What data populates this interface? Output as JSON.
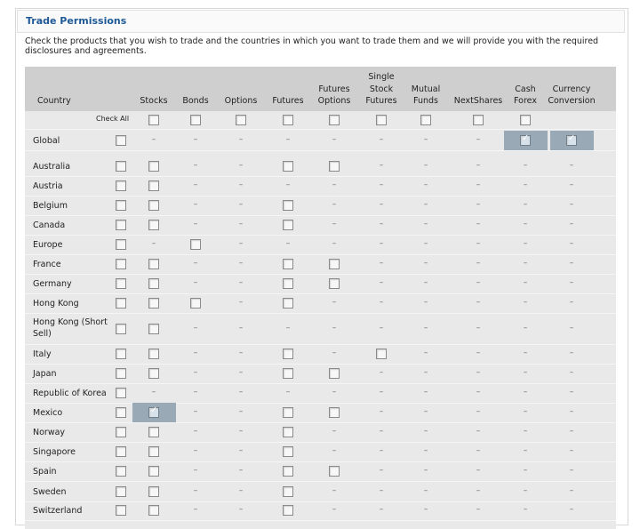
{
  "title": "Trade Permissions",
  "intro": "Check the products that you wish to trade and the countries in which you want to trade them and we will provide you with the required disclosures and agreements.",
  "header": {
    "country": "Country",
    "columns": [
      {
        "key": "stocks",
        "lines": [
          "Stocks"
        ]
      },
      {
        "key": "bonds",
        "lines": [
          "Bonds"
        ]
      },
      {
        "key": "options",
        "lines": [
          "Options"
        ]
      },
      {
        "key": "futures",
        "lines": [
          "Futures"
        ]
      },
      {
        "key": "futures_options",
        "lines": [
          "Futures",
          "Options"
        ]
      },
      {
        "key": "single_stock_futures",
        "lines": [
          "Single",
          "Stock",
          "Futures"
        ]
      },
      {
        "key": "mutual_funds",
        "lines": [
          "Mutual",
          "Funds"
        ]
      },
      {
        "key": "nextshares",
        "lines": [
          "NextShares"
        ]
      },
      {
        "key": "cash_forex",
        "lines": [
          "Cash",
          "Forex"
        ]
      },
      {
        "key": "currency_conversion",
        "lines": [
          "Currency",
          "Conversion"
        ]
      }
    ]
  },
  "check_all_label": "Check All",
  "check_all": [
    "box",
    "box",
    "box",
    "box",
    "box",
    "box",
    "box",
    "box",
    "box",
    "none"
  ],
  "rows": [
    {
      "country": "Global",
      "cells": [
        "dash",
        "dash",
        "dash",
        "dash",
        "dash",
        "dash",
        "dash",
        "dash",
        "checked",
        "checked"
      ]
    },
    {
      "country": "Australia",
      "cells": [
        "box",
        "dash",
        "dash",
        "box",
        "box",
        "dash",
        "dash",
        "dash",
        "dash",
        "dash"
      ]
    },
    {
      "country": "Austria",
      "cells": [
        "box",
        "dash",
        "dash",
        "dash",
        "dash",
        "dash",
        "dash",
        "dash",
        "dash",
        "dash"
      ]
    },
    {
      "country": "Belgium",
      "cells": [
        "box",
        "dash",
        "dash",
        "box",
        "dash",
        "dash",
        "dash",
        "dash",
        "dash",
        "dash"
      ]
    },
    {
      "country": "Canada",
      "cells": [
        "box",
        "dash",
        "dash",
        "box",
        "dash",
        "dash",
        "dash",
        "dash",
        "dash",
        "dash"
      ]
    },
    {
      "country": "Europe",
      "cells": [
        "dash",
        "box",
        "dash",
        "dash",
        "dash",
        "dash",
        "dash",
        "dash",
        "dash",
        "dash"
      ]
    },
    {
      "country": "France",
      "cells": [
        "box",
        "dash",
        "dash",
        "box",
        "box",
        "dash",
        "dash",
        "dash",
        "dash",
        "dash"
      ]
    },
    {
      "country": "Germany",
      "cells": [
        "box",
        "dash",
        "dash",
        "box",
        "box",
        "dash",
        "dash",
        "dash",
        "dash",
        "dash"
      ]
    },
    {
      "country": "Hong Kong",
      "cells": [
        "box",
        "box",
        "dash",
        "box",
        "dash",
        "dash",
        "dash",
        "dash",
        "dash",
        "dash"
      ]
    },
    {
      "country": "Hong Kong (Short Sell)",
      "cells": [
        "box",
        "dash",
        "dash",
        "dash",
        "dash",
        "dash",
        "dash",
        "dash",
        "dash",
        "dash"
      ]
    },
    {
      "country": "Italy",
      "cells": [
        "box",
        "dash",
        "dash",
        "box",
        "dash",
        "box",
        "dash",
        "dash",
        "dash",
        "dash"
      ]
    },
    {
      "country": "Japan",
      "cells": [
        "box",
        "dash",
        "dash",
        "box",
        "box",
        "dash",
        "dash",
        "dash",
        "dash",
        "dash"
      ]
    },
    {
      "country": "Republic of Korea",
      "cells": [
        "dash",
        "dash",
        "dash",
        "dash",
        "dash",
        "dash",
        "dash",
        "dash",
        "dash",
        "dash"
      ]
    },
    {
      "country": "Mexico",
      "cells": [
        "checked",
        "dash",
        "dash",
        "box",
        "box",
        "dash",
        "dash",
        "dash",
        "dash",
        "dash"
      ]
    },
    {
      "country": "Norway",
      "cells": [
        "box",
        "dash",
        "dash",
        "box",
        "dash",
        "dash",
        "dash",
        "dash",
        "dash",
        "dash"
      ]
    },
    {
      "country": "Singapore",
      "cells": [
        "box",
        "dash",
        "dash",
        "box",
        "dash",
        "dash",
        "dash",
        "dash",
        "dash",
        "dash"
      ]
    },
    {
      "country": "Spain",
      "cells": [
        "box",
        "dash",
        "dash",
        "box",
        "box",
        "dash",
        "dash",
        "dash",
        "dash",
        "dash"
      ]
    },
    {
      "country": "Sweden",
      "cells": [
        "box",
        "dash",
        "dash",
        "box",
        "dash",
        "dash",
        "dash",
        "dash",
        "dash",
        "dash"
      ]
    },
    {
      "country": "Switzerland",
      "cells": [
        "box",
        "dash",
        "dash",
        "box",
        "dash",
        "dash",
        "dash",
        "dash",
        "dash",
        "dash"
      ]
    }
  ],
  "dash_char": "–",
  "colors": {
    "title": "#1f5a96",
    "header_bg": "#cfcfcf",
    "grid_bg": "#e9e9e9",
    "highlight": "#9aa9b6"
  }
}
